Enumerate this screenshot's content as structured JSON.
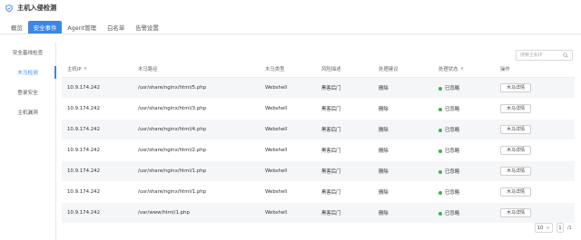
{
  "window": {
    "title": "主机入侵检测",
    "accent_color": "#3a87ea"
  },
  "tabs": [
    {
      "label": "概览",
      "active": false
    },
    {
      "label": "安全事件",
      "active": true
    },
    {
      "label": "Agent管理",
      "active": false
    },
    {
      "label": "白名单",
      "active": false
    },
    {
      "label": "告警设置",
      "active": false
    }
  ],
  "sidebar": {
    "items": [
      {
        "label": "安全基线检查",
        "active": false
      },
      {
        "label": "木马检测",
        "active": true
      },
      {
        "label": "登录安全",
        "active": false
      },
      {
        "label": "主机漏洞",
        "active": false
      }
    ]
  },
  "search": {
    "placeholder": "搜索主机IP",
    "value": ""
  },
  "table": {
    "columns": [
      "主机IP",
      "木马路径",
      "木马类型",
      "风险描述",
      "处理建议",
      "处理状态",
      "操作"
    ],
    "rows": [
      {
        "ip": "10.9.174.242",
        "path": "/usr/share/nginx/html/5.php",
        "type": "Webshell",
        "risk": "黑客后门",
        "suggestion": "删除",
        "status": "已忽略",
        "action": "木马详情"
      },
      {
        "ip": "10.9.174.242",
        "path": "/usr/share/nginx/html/3.php",
        "type": "Webshell",
        "risk": "黑客后门",
        "suggestion": "删除",
        "status": "已忽略",
        "action": "木马详情"
      },
      {
        "ip": "10.9.174.242",
        "path": "/usr/share/nginx/html/4.php",
        "type": "Webshell",
        "risk": "黑客后门",
        "suggestion": "删除",
        "status": "已忽略",
        "action": "木马详情"
      },
      {
        "ip": "10.9.174.242",
        "path": "/usr/share/nginx/html/2.php",
        "type": "Webshell",
        "risk": "黑客后门",
        "suggestion": "删除",
        "status": "已忽略",
        "action": "木马详情"
      },
      {
        "ip": "10.9.174.242",
        "path": "/usr/share/nginx/html/1.php",
        "type": "Webshell",
        "risk": "黑客后门",
        "suggestion": "删除",
        "status": "已忽略",
        "action": "木马详情"
      },
      {
        "ip": "10.9.174.242",
        "path": "/usr/share/nginx/html/1.php",
        "type": "Webshell",
        "risk": "黑客后门",
        "suggestion": "删除",
        "status": "已忽略",
        "action": "木马详情"
      },
      {
        "ip": "10.9.174.242",
        "path": "/var/www/html/1.php",
        "type": "Webshell",
        "risk": "黑客后门",
        "suggestion": "删除",
        "status": "已忽略",
        "action": "木马详情"
      }
    ],
    "status_color": "#3cb34a"
  },
  "pagination": {
    "page_size": "10",
    "current_page": "1",
    "total": "/1"
  }
}
